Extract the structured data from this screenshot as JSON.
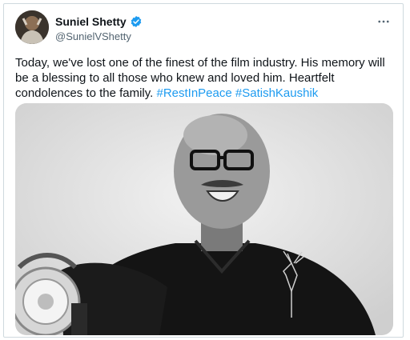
{
  "author": {
    "name": "Suniel Shetty",
    "handle": "@SunielVShetty",
    "verified_icon": "verified-badge-icon"
  },
  "more_icon": "more-options-icon",
  "tweet": {
    "text_plain": "Today, we've lost one of the finest of the film industry. His memory will be a blessing to all those who knew and loved him. Heartfelt condolences to the family. ",
    "hashtags": [
      "#RestInPeace",
      "#SatishKaushik"
    ]
  },
  "colors": {
    "accent": "#1d9bf0",
    "text": "#0f1419",
    "muted": "#536471",
    "border": "#cfd9de"
  }
}
